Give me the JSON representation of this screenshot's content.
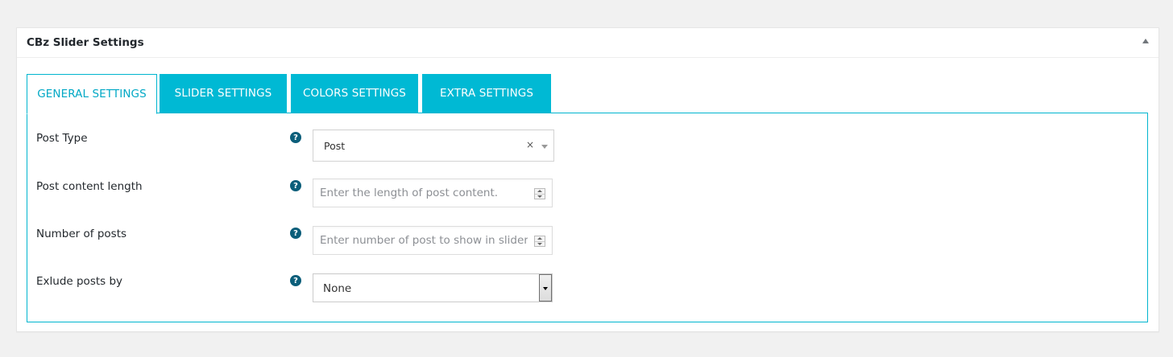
{
  "postbox": {
    "title": "CBz Slider Settings"
  },
  "tabs": [
    {
      "label": "GENERAL SETTINGS",
      "active": true
    },
    {
      "label": "SLIDER SETTINGS",
      "active": false
    },
    {
      "label": "COLORS SETTINGS",
      "active": false
    },
    {
      "label": "EXTRA SETTINGS",
      "active": false
    }
  ],
  "fields": {
    "post_type": {
      "label": "Post Type",
      "value": "Post",
      "clear": "×"
    },
    "content_length": {
      "label": "Post content length",
      "value": "",
      "placeholder": "Enter the length of post content."
    },
    "num_posts": {
      "label": "Number of posts",
      "value": "",
      "placeholder": "Enter number of post to show in slider."
    },
    "exclude_by": {
      "label": "Exlude posts by",
      "value": "None"
    }
  },
  "help_glyph": "?",
  "colors": {
    "tab_bg": "#00b9d4",
    "tab_active_text": "#00a8c5",
    "panel_border": "#00b5cf",
    "help_icon_bg": "#0b5e7a"
  }
}
